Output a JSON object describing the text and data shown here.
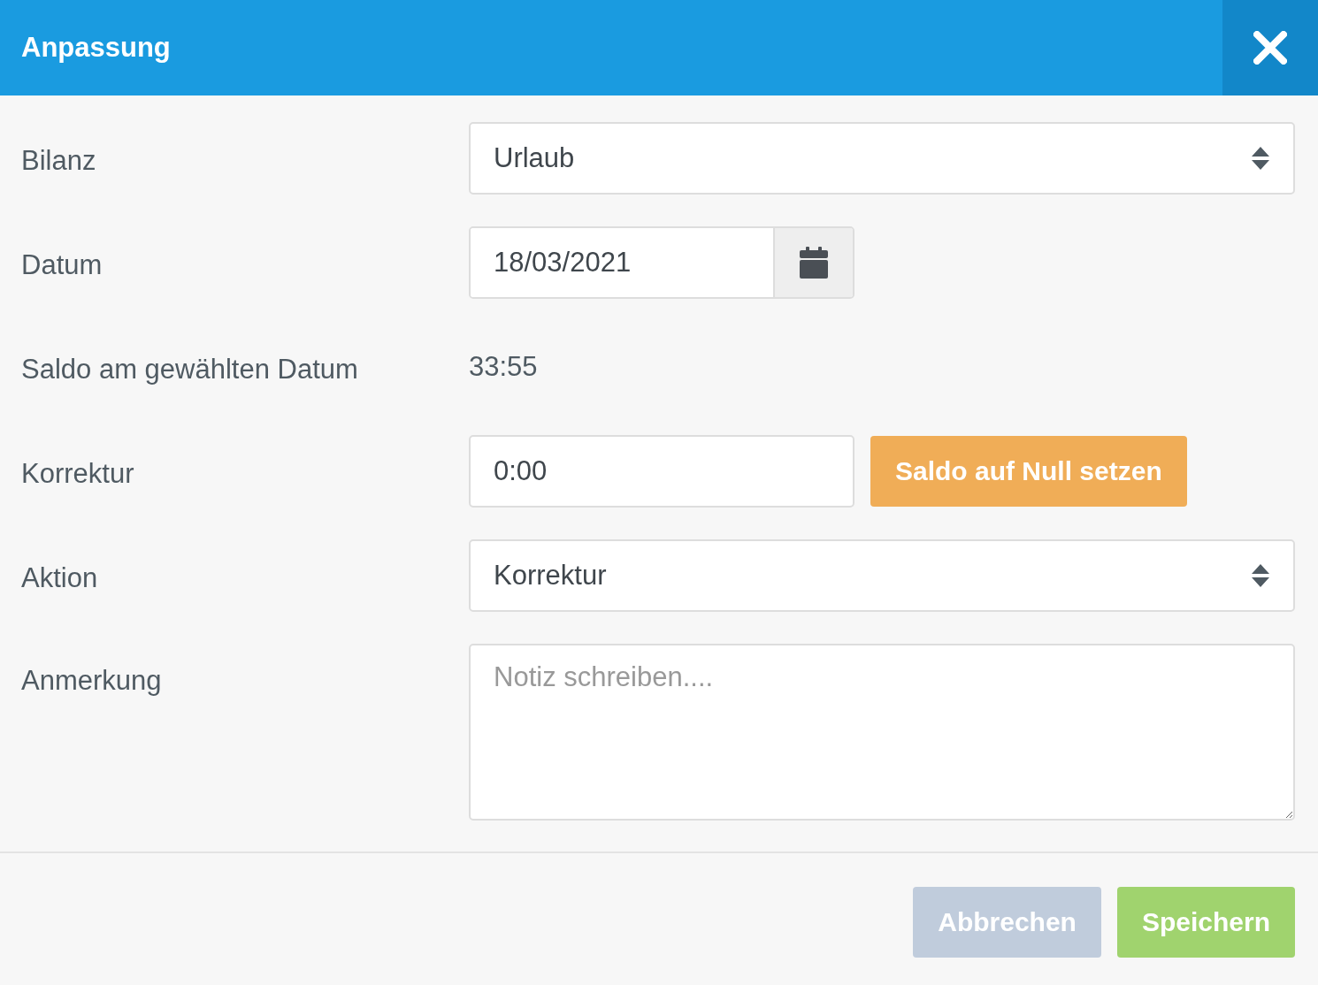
{
  "dialog": {
    "title": "Anpassung"
  },
  "fields": [
    {
      "kind": "select",
      "label": "Bilanz",
      "value": "Urlaub"
    },
    {
      "kind": "date",
      "label": "Datum",
      "value": "18/03/2021"
    },
    {
      "kind": "text",
      "label": "Saldo am gewählten Datum",
      "value": "33:55"
    },
    {
      "kind": "input_with_button",
      "label": "Korrektur",
      "value": "0:00",
      "button": "Saldo auf Null setzen"
    },
    {
      "kind": "select",
      "label": "Aktion",
      "value": "Korrektur"
    },
    {
      "kind": "textarea",
      "label": "Anmerkung",
      "placeholder": "Notiz schreiben...."
    }
  ],
  "buttons": [
    {
      "kind": "cancel",
      "label": "Abbrechen"
    },
    {
      "kind": "save",
      "label": "Speichern"
    }
  ]
}
